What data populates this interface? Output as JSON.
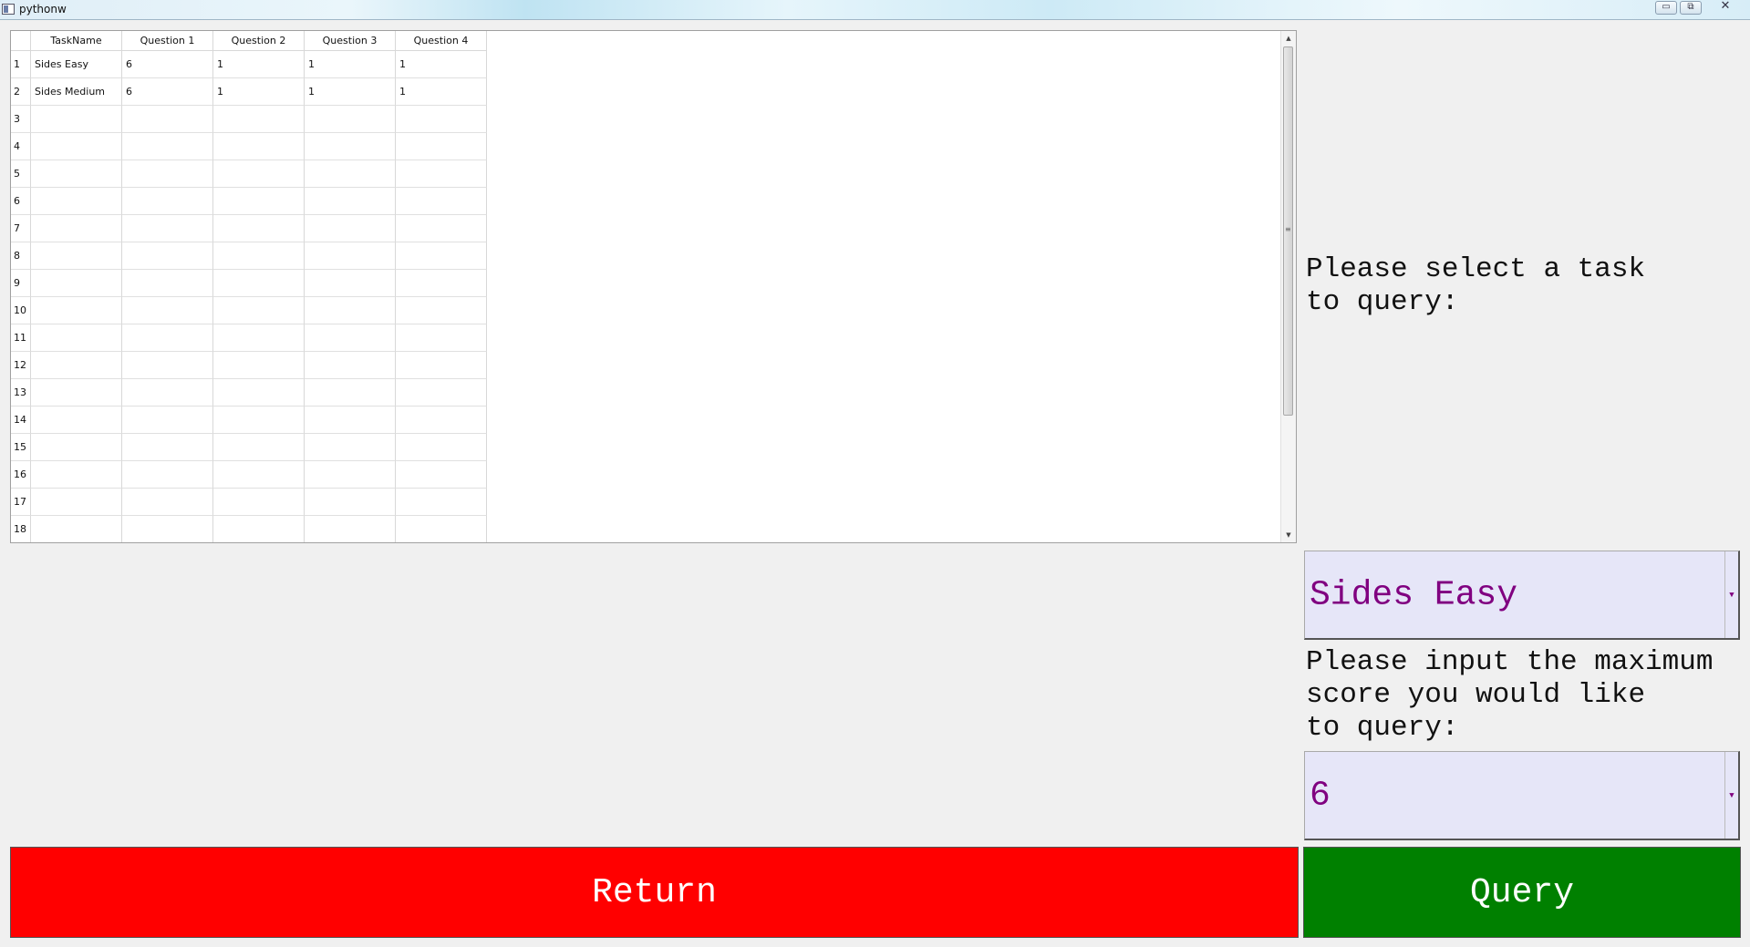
{
  "window": {
    "title": "pythonw",
    "minimize_glyph": "▭",
    "maximize_glyph": "⧉",
    "close_glyph": "✕"
  },
  "table": {
    "columns": [
      "TaskName",
      "Question 1",
      "Question 2",
      "Question 3",
      "Question 4"
    ],
    "row_numbers": [
      "1",
      "2",
      "3",
      "4",
      "5",
      "6",
      "7",
      "8",
      "9",
      "10",
      "11",
      "12",
      "13",
      "14",
      "15",
      "16",
      "17",
      "18"
    ],
    "rows": [
      [
        "Sides Easy",
        "6",
        "1",
        "1",
        "1"
      ],
      [
        "Sides Medium",
        "6",
        "1",
        "1",
        "1"
      ]
    ],
    "scroll_up": "▲",
    "scroll_down": "▼",
    "scroll_grip": "≡"
  },
  "task_prompt": "Please select a task\nto query:",
  "task_select": {
    "value": "Sides Easy",
    "arrow": "▼"
  },
  "score_prompt": "Please input the maximum\nscore you would like\nto query:",
  "score_select": {
    "value": "6",
    "arrow": "▼"
  },
  "buttons": {
    "return_label": "Return",
    "query_label": "Query"
  },
  "colors": {
    "return_bg": "#ff0000",
    "query_bg": "#008000",
    "select_bg": "#e6e6f8",
    "select_text": "#800080"
  }
}
